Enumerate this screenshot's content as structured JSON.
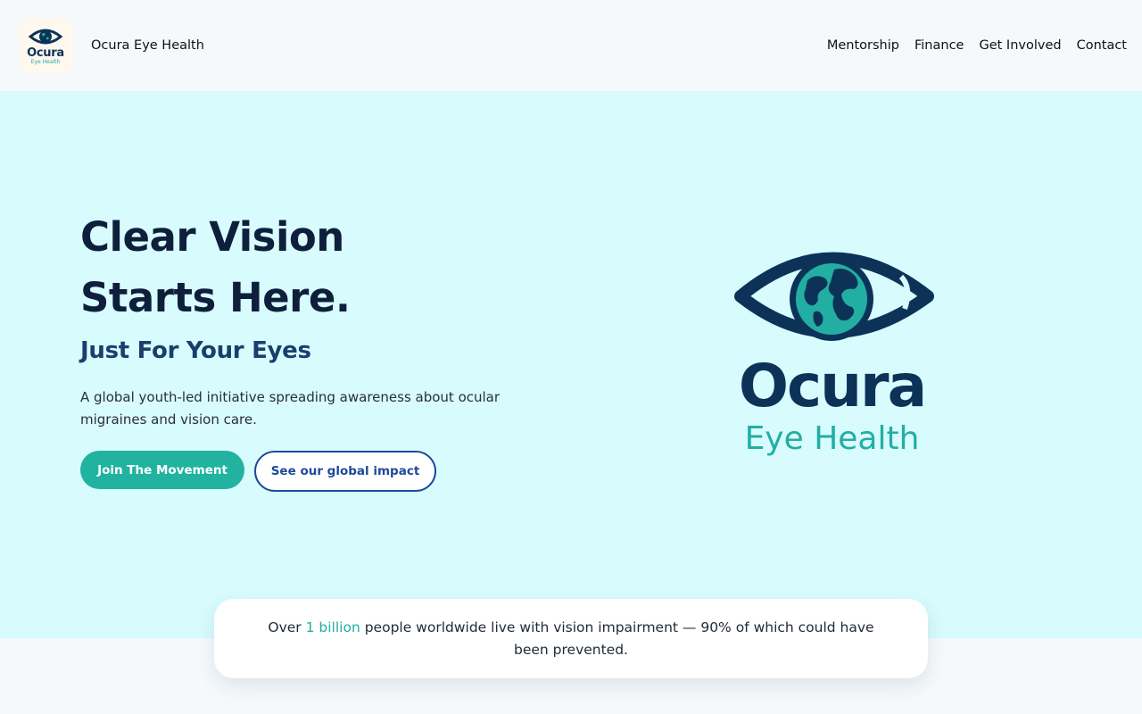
{
  "header": {
    "brand_name": "Ocura Eye Health",
    "logo_text": "Ocura",
    "logo_subtext": "Eye Health",
    "nav": [
      "Mentorship",
      "Finance",
      "Get Involved",
      "Contact"
    ]
  },
  "hero": {
    "headline_line1": "Clear Vision",
    "headline_line2": "Starts Here.",
    "subheadline": "Just For Your Eyes",
    "tagline": "A global youth-led initiative spreading awareness about ocular migraines and vision care.",
    "primary_button": "Join The Movement",
    "secondary_button": "See our global impact",
    "logo_text": "Ocura",
    "logo_subtext": "Eye Health"
  },
  "stat": {
    "prefix": "Over ",
    "highlight": "1 billion",
    "suffix": " people worldwide live with vision impairment — 90% of which could have been prevented."
  },
  "colors": {
    "navy": "#0c3357",
    "teal": "#23aea3",
    "hero_bg": "#d8fbfd",
    "button_primary": "#21b3a0",
    "button_secondary_border": "#1e4a9a"
  },
  "icons": {
    "brand_logo": "eye-globe-icon",
    "hero_logo": "eye-globe-icon"
  }
}
